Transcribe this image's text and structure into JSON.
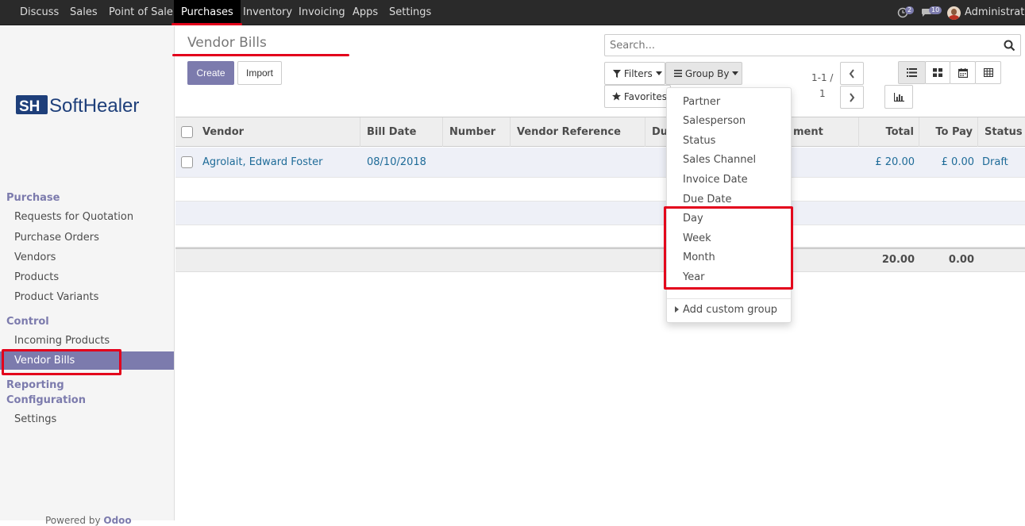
{
  "topnav": {
    "items": [
      "Discuss",
      "Sales",
      "Point of Sale",
      "Purchases",
      "Inventory",
      "Invoicing",
      "Apps",
      "Settings"
    ],
    "active": "Purchases",
    "chat_count": "2",
    "messages_count": "10",
    "user": "Administrator"
  },
  "sidebar": {
    "logo_text": "SoftHealer",
    "logo_mark": "SH",
    "sections": [
      {
        "title": "Purchase",
        "items": [
          "Requests for Quotation",
          "Purchase Orders",
          "Vendors",
          "Products",
          "Product Variants"
        ]
      },
      {
        "title": "Control",
        "items": [
          "Incoming Products",
          "Vendor Bills"
        ]
      },
      {
        "title": "Reporting",
        "items": []
      },
      {
        "title": "Configuration",
        "items": [
          "Settings"
        ]
      }
    ],
    "active_item": "Vendor Bills",
    "powered_by": "Powered by",
    "powered_brand": "Odoo"
  },
  "control_panel": {
    "title": "Vendor Bills",
    "create_label": "Create",
    "import_label": "Import",
    "search_placeholder": "Search...",
    "filters_label": "Filters",
    "group_by_label": "Group By",
    "favorites_label": "Favorites",
    "pager_line1": "1-1 /",
    "pager_line2": "1"
  },
  "table": {
    "columns": [
      "Vendor",
      "Bill Date",
      "Number",
      "Vendor Reference",
      "Du",
      "ment",
      "Total",
      "To Pay",
      "Status"
    ],
    "rows": [
      {
        "vendor": "Agrolait, Edward Foster",
        "bill_date": "08/10/2018",
        "number": "",
        "vendor_ref": "",
        "total": "£ 20.00",
        "to_pay": "£ 0.00",
        "status": "Draft"
      }
    ],
    "footer": {
      "total": "20.00",
      "to_pay": "0.00"
    }
  },
  "group_by_menu": {
    "items": [
      "Partner",
      "Salesperson",
      "Status",
      "Sales Channel",
      "Invoice Date",
      "Due Date",
      "Day",
      "Week",
      "Month",
      "Year"
    ],
    "custom_label": "Add custom group"
  },
  "colors": {
    "accent": "#7c7bad",
    "highlight": "#e3001b",
    "link": "#1e6b98",
    "topbar": "#2a2a2a"
  }
}
